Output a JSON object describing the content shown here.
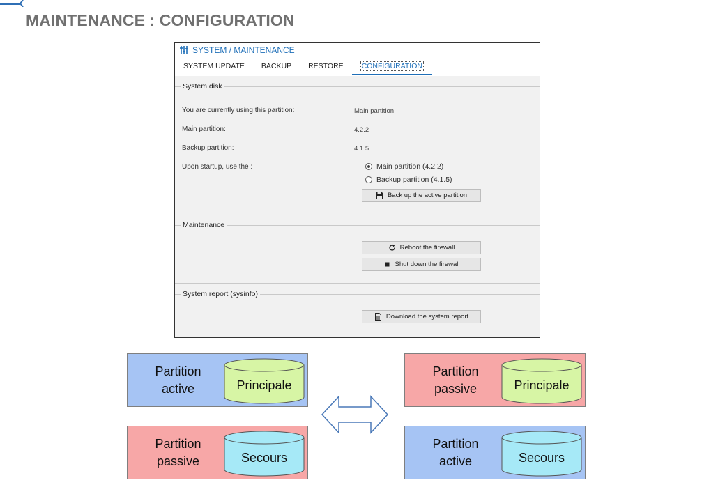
{
  "slide": {
    "title": "MAINTENANCE : CONFIGURATION"
  },
  "window": {
    "header_icon": "sliders-icon",
    "header_title": "SYSTEM / MAINTENANCE",
    "tabs": [
      {
        "label": "SYSTEM UPDATE",
        "active": false
      },
      {
        "label": "BACKUP",
        "active": false
      },
      {
        "label": "RESTORE",
        "active": false
      },
      {
        "label": "CONFIGURATION",
        "active": true
      }
    ],
    "system_disk": {
      "legend": "System disk",
      "current_label": "You are currently using this partition:",
      "current_value": "Main partition",
      "main_label": "Main partition:",
      "main_value": "4.2.2",
      "backup_label": "Backup partition:",
      "backup_value": "4.1.5",
      "startup_label": "Upon startup, use the :",
      "startup_options": [
        {
          "label": "Main partition (4.2.2)",
          "checked": true
        },
        {
          "label": "Backup partition (4.1.5)",
          "checked": false
        }
      ],
      "backup_button": {
        "label": "Back up the active partition",
        "icon": "floppy-disk-icon"
      }
    },
    "maintenance": {
      "legend": "Maintenance",
      "reboot_button": {
        "label": "Reboot the firewall",
        "icon": "refresh-icon"
      },
      "shutdown_button": {
        "label": "Shut down the firewall",
        "icon": "stop-icon"
      }
    },
    "sysinfo": {
      "legend": "System report (sysinfo)",
      "download_button": {
        "label": "Download the system report",
        "icon": "document-icon"
      }
    }
  },
  "diagram": {
    "colors": {
      "active": "#a6c4f4",
      "passive": "#f7a7a7",
      "principale_disk": "#d7f5a5",
      "secours_disk": "#a6e9f7"
    },
    "left": [
      {
        "state": "Partition\nactive",
        "disk": "Principale"
      },
      {
        "state": "Partition\npassive",
        "disk": "Secours"
      }
    ],
    "right": [
      {
        "state": "Partition\npassive",
        "disk": "Principale"
      },
      {
        "state": "Partition\nactive",
        "disk": "Secours"
      }
    ],
    "swap_icon": "double-arrow-icon"
  }
}
